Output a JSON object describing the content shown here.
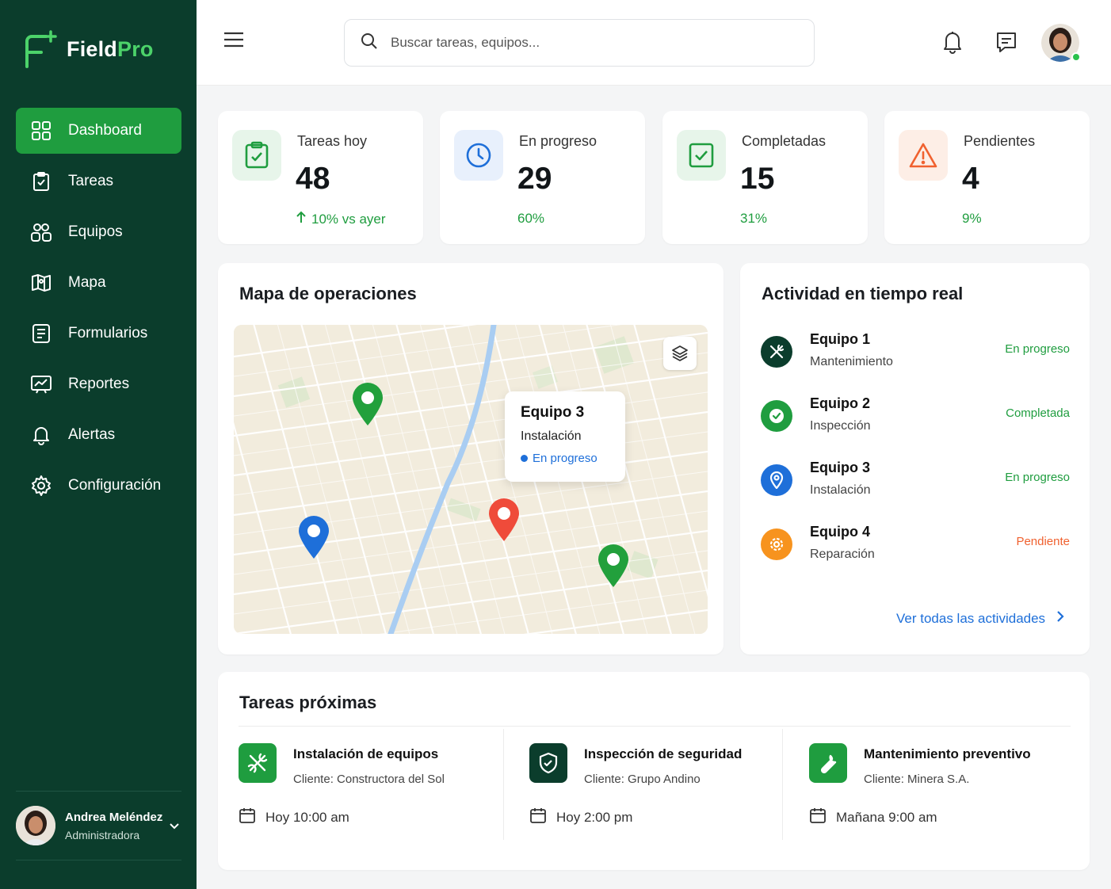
{
  "app": {
    "logo_text_main": "Field",
    "logo_text_accent": "Pro",
    "brand_green": "#1f9d3f",
    "sidebar_bg": "#0b3d2c"
  },
  "sidebar": {
    "items": [
      {
        "label": "Dashboard",
        "icon": "dashboard-grid-icon",
        "active": true
      },
      {
        "label": "Tareas",
        "icon": "clipboard-check-icon"
      },
      {
        "label": "Equipos",
        "icon": "team-icon"
      },
      {
        "label": "Mapa",
        "icon": "map-icon"
      },
      {
        "label": "Formularios",
        "icon": "form-icon"
      },
      {
        "label": "Reportes",
        "icon": "report-icon"
      },
      {
        "label": "Alertas",
        "icon": "bell-icon"
      },
      {
        "label": "Configuración",
        "icon": "gear-icon"
      }
    ],
    "user": {
      "name": "Andrea Meléndez",
      "role": "Administradora"
    }
  },
  "topbar": {
    "search_placeholder": "Buscar tareas, equipos..."
  },
  "stats": [
    {
      "label": "Tareas hoy",
      "value": "48",
      "sub": "10% vs ayer",
      "icon": "clipboard-check-icon",
      "icon_color": "#1f9d3f",
      "icon_bg": "#e7f5ea"
    },
    {
      "label": "En progreso",
      "value": "29",
      "sub": "60%",
      "icon": "clock-icon",
      "icon_color": "#1e6fd9",
      "icon_bg": "#e8f0fc"
    },
    {
      "label": "Completadas",
      "value": "15",
      "sub": "31%",
      "icon": "check-square-icon",
      "icon_color": "#1f9d3f",
      "icon_bg": "#e7f5ea"
    },
    {
      "label": "Pendientes",
      "value": "4",
      "sub": "9%",
      "icon": "warning-icon",
      "icon_color": "#f0612f",
      "icon_bg": "#fdeee6"
    }
  ],
  "map_card": {
    "title": "Mapa de operaciones",
    "popup": {
      "title": "Equipo 3",
      "subtitle": "Instalación",
      "status": "En progreso"
    }
  },
  "activity": {
    "title": "Actividad en tiempo real",
    "items": [
      {
        "name": "Equipo 1",
        "type": "Mantenimiento",
        "status": "En progreso",
        "status_color": "#1f9d3f",
        "icon": "tools-icon",
        "icon_bg": "#0b3d2c"
      },
      {
        "name": "Equipo 2",
        "type": "Inspección",
        "status": "Completada",
        "status_color": "#1f9d3f",
        "icon": "check-circle-icon",
        "icon_bg": "#1f9d3f"
      },
      {
        "name": "Equipo 3",
        "type": "Instalación",
        "status": "En progreso",
        "status_color": "#1f9d3f",
        "icon": "location-icon",
        "icon_bg": "#1e6fd9"
      },
      {
        "name": "Equipo 4",
        "type": "Reparación",
        "status": "Pendiente",
        "status_color": "#f0612f",
        "icon": "gear-icon",
        "icon_bg": "#f7931e"
      }
    ],
    "see_all": "Ver todas las actividades"
  },
  "tasks": {
    "title": "Tareas próximas",
    "items": [
      {
        "title": "Instalación de equipos",
        "client": "Cliente: Constructora del Sol",
        "when": "Hoy 10:00 am",
        "icon": "tools-icon",
        "icon_bg": "#1f9d3f"
      },
      {
        "title": "Inspección de seguridad",
        "client": "Cliente: Grupo Andino",
        "when": "Hoy 2:00 pm",
        "icon": "shield-check-icon",
        "icon_bg": "#0b3d2c"
      },
      {
        "title": "Mantenimiento preventivo",
        "client": "Cliente: Minera S.A.",
        "when": "Mañana 9:00 am",
        "icon": "wrench-icon",
        "icon_bg": "#1f9d3f"
      }
    ]
  }
}
